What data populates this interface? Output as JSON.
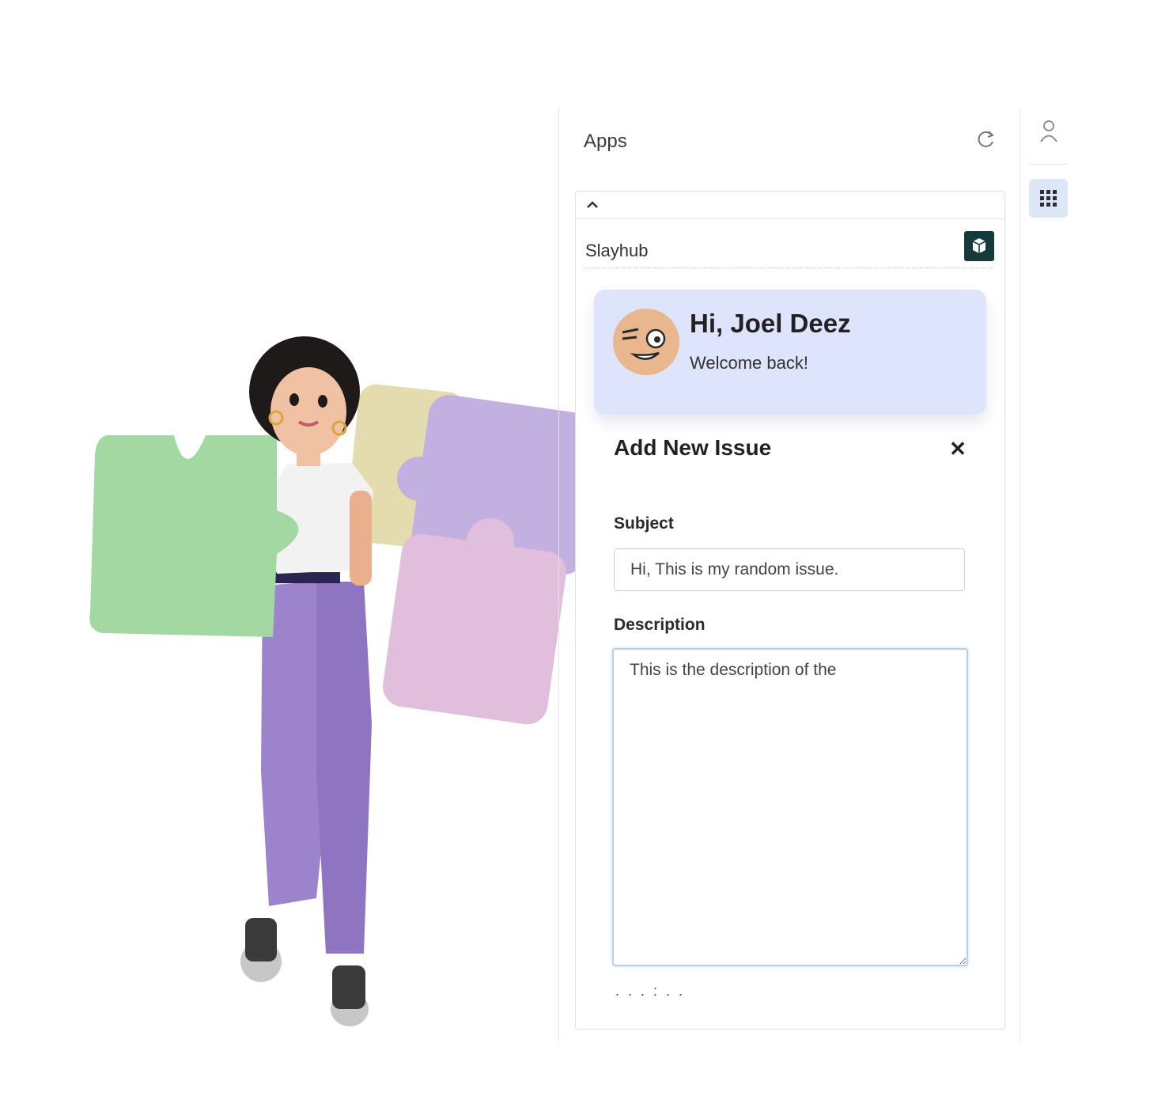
{
  "apps_panel": {
    "title": "Apps",
    "refresh_icon": "refresh-icon",
    "collapse_icon": "chevron-up-icon"
  },
  "app": {
    "name": "Slayhub",
    "icon": "cube-icon",
    "icon_color": "#163a3c"
  },
  "welcome": {
    "greeting": "Hi, Joel Deez",
    "subtitle": "Welcome back!",
    "background": "#dde4fb"
  },
  "issue_form": {
    "title": "Add New Issue",
    "close_icon": "close-icon",
    "subject_label": "Subject",
    "subject_value": "Hi, This is my random issue.",
    "description_label": "Description",
    "description_value": "This is the description of the "
  },
  "right_rail": {
    "items": [
      {
        "icon": "user-icon"
      },
      {
        "icon": "grid-icon",
        "active": true
      }
    ]
  }
}
